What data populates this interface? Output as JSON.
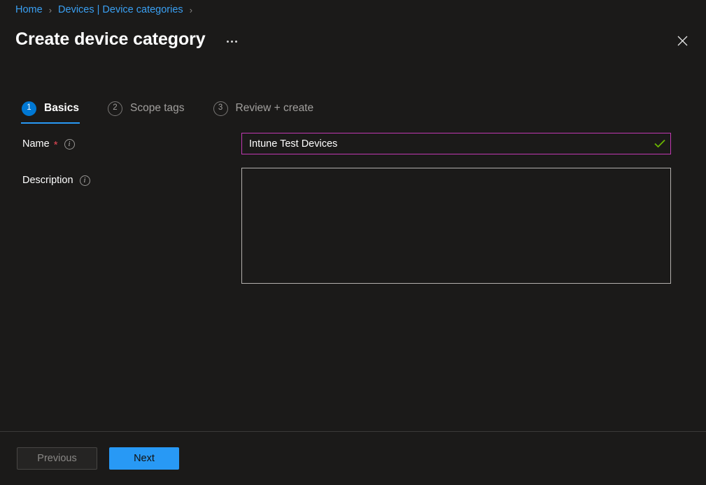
{
  "breadcrumb": {
    "items": [
      {
        "label": "Home",
        "icon": ""
      },
      {
        "label": "Devices | Device categories",
        "icon": ""
      }
    ],
    "separator": "›"
  },
  "header": {
    "title": "Create device category",
    "more_menu_icon": "ellipsis-icon",
    "close_icon": "close-icon"
  },
  "wizard": {
    "tabs": [
      {
        "number": "1",
        "label": "Basics",
        "state": "active"
      },
      {
        "number": "2",
        "label": "Scope tags",
        "state": "inactive"
      },
      {
        "number": "3",
        "label": "Review + create",
        "state": "inactive"
      }
    ],
    "active_accent_color": "#2899f5"
  },
  "form": {
    "name": {
      "label": "Name",
      "required_marker": "*",
      "info_icon": "info-icon",
      "value": "Intune Test Devices",
      "placeholder": "",
      "border_color": "#c239b3",
      "validation_icon": "checkmark-icon",
      "validation_color": "#6bb700"
    },
    "description": {
      "label": "Description",
      "info_icon": "info-icon",
      "value": "",
      "placeholder": "",
      "border_color": "#b3b0ad"
    }
  },
  "footer": {
    "previous_label": "Previous",
    "next_label": "Next",
    "next_color": "#2899f5"
  }
}
